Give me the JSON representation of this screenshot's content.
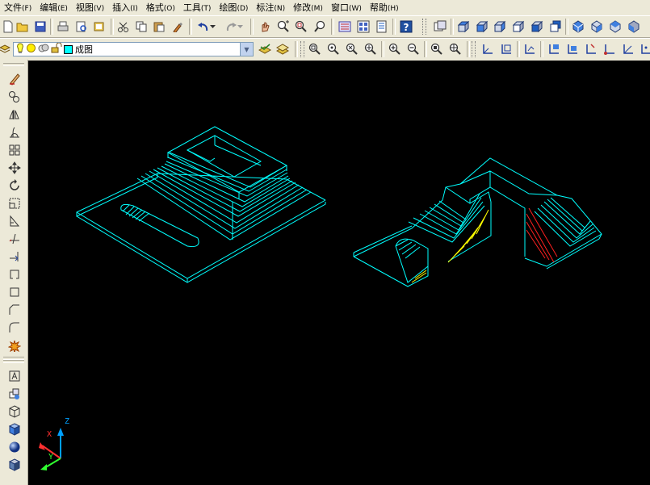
{
  "menubar": {
    "items": [
      {
        "label": "文件",
        "accel": "(F)"
      },
      {
        "label": "编辑",
        "accel": "(E)"
      },
      {
        "label": "视图",
        "accel": "(V)"
      },
      {
        "label": "插入",
        "accel": "(I)"
      },
      {
        "label": "格式",
        "accel": "(O)"
      },
      {
        "label": "工具",
        "accel": "(T)"
      },
      {
        "label": "绘图",
        "accel": "(D)"
      },
      {
        "label": "标注",
        "accel": "(N)"
      },
      {
        "label": "修改",
        "accel": "(M)"
      },
      {
        "label": "窗口",
        "accel": "(W)"
      },
      {
        "label": "帮助",
        "accel": "(H)"
      }
    ]
  },
  "layers": {
    "current_layer": "成图",
    "layer_color": "#00ffff"
  },
  "ucs": {
    "z_label": "Z",
    "x_label": "X",
    "y_label": "Y"
  },
  "colors": {
    "drawing_lines": "#00ffff",
    "hatch_yellow": "#ffff00",
    "hatch_red": "#ff2020",
    "ucs_z": "#00a0ff",
    "ucs_x": "#ff3030",
    "ucs_y": "#30ff30"
  }
}
